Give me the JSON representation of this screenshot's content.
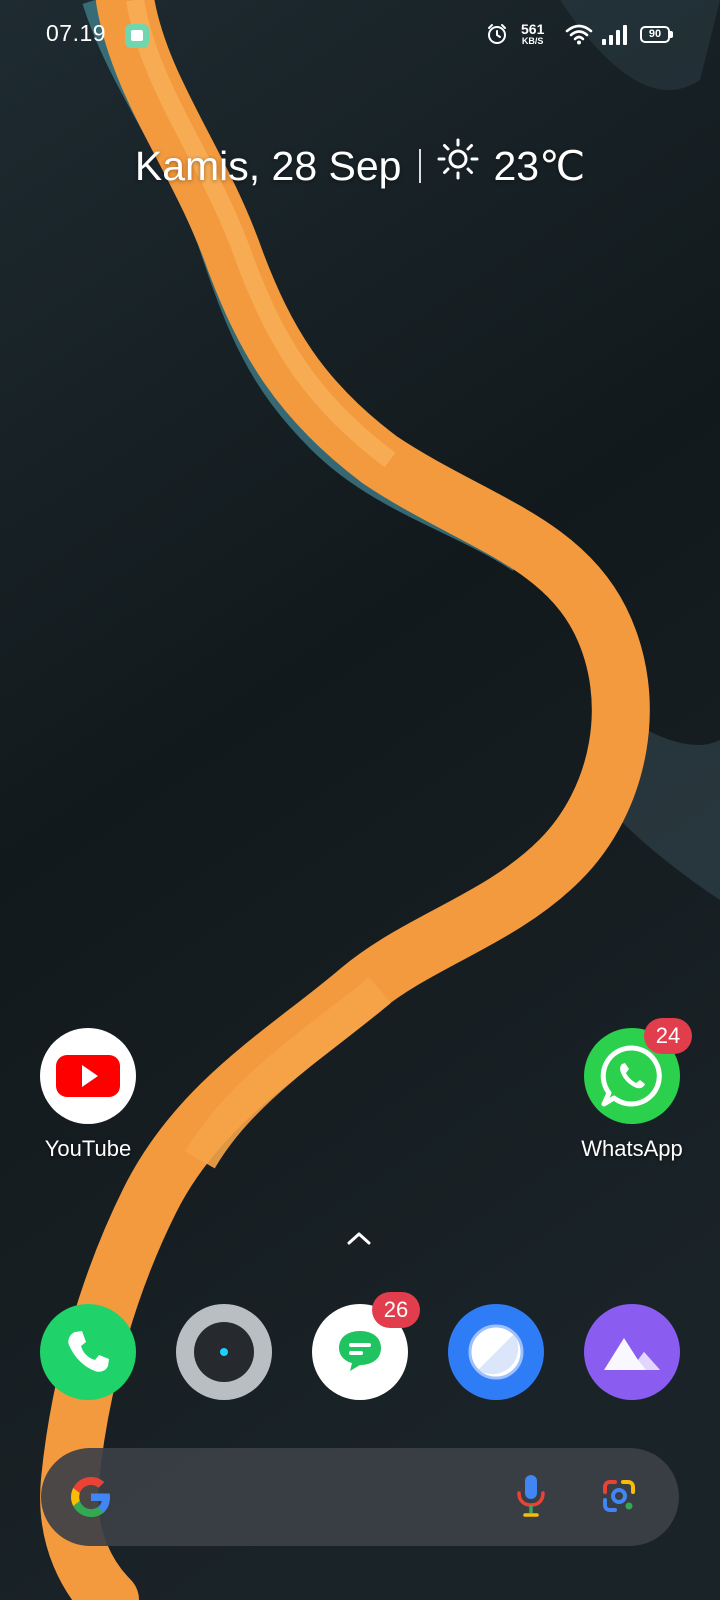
{
  "status_bar": {
    "time": "07.19",
    "notification_app_icon": "green-app-icon",
    "alarm_icon": "alarm-clock-icon",
    "net_speed_value": "561",
    "net_speed_unit": "KB/S",
    "wifi_icon": "wifi-icon",
    "signal_icon": "cell-signal-icon",
    "battery_level": "90"
  },
  "date_widget": {
    "date": "Kamis, 28 Sep",
    "weather_icon": "sun-icon",
    "temperature": "23℃"
  },
  "home_apps": [
    {
      "label": "YouTube",
      "icon": "youtube-icon",
      "badge": null
    },
    {
      "label": "WhatsApp",
      "icon": "whatsapp-icon",
      "badge": "24"
    }
  ],
  "dock": [
    {
      "icon": "phone-icon",
      "badge": null
    },
    {
      "icon": "camera-icon",
      "badge": null
    },
    {
      "icon": "messages-icon",
      "badge": "26"
    },
    {
      "icon": "browser-icon",
      "badge": null
    },
    {
      "icon": "gallery-icon",
      "badge": null
    }
  ],
  "drawer_icon": "chevron-up-icon",
  "search_bar": {
    "logo_icon": "google-g-icon",
    "voice_icon": "microphone-icon",
    "lens_icon": "google-lens-icon"
  },
  "colors": {
    "youtube_red": "#ff0000",
    "whatsapp_green": "#2bd04c",
    "phone_green": "#1fd36a",
    "browser_blue": "#2f7df6",
    "gallery_purple": "#8a5cf0",
    "badge_red": "#e23d4d",
    "river_orange": "#f39a3e"
  }
}
